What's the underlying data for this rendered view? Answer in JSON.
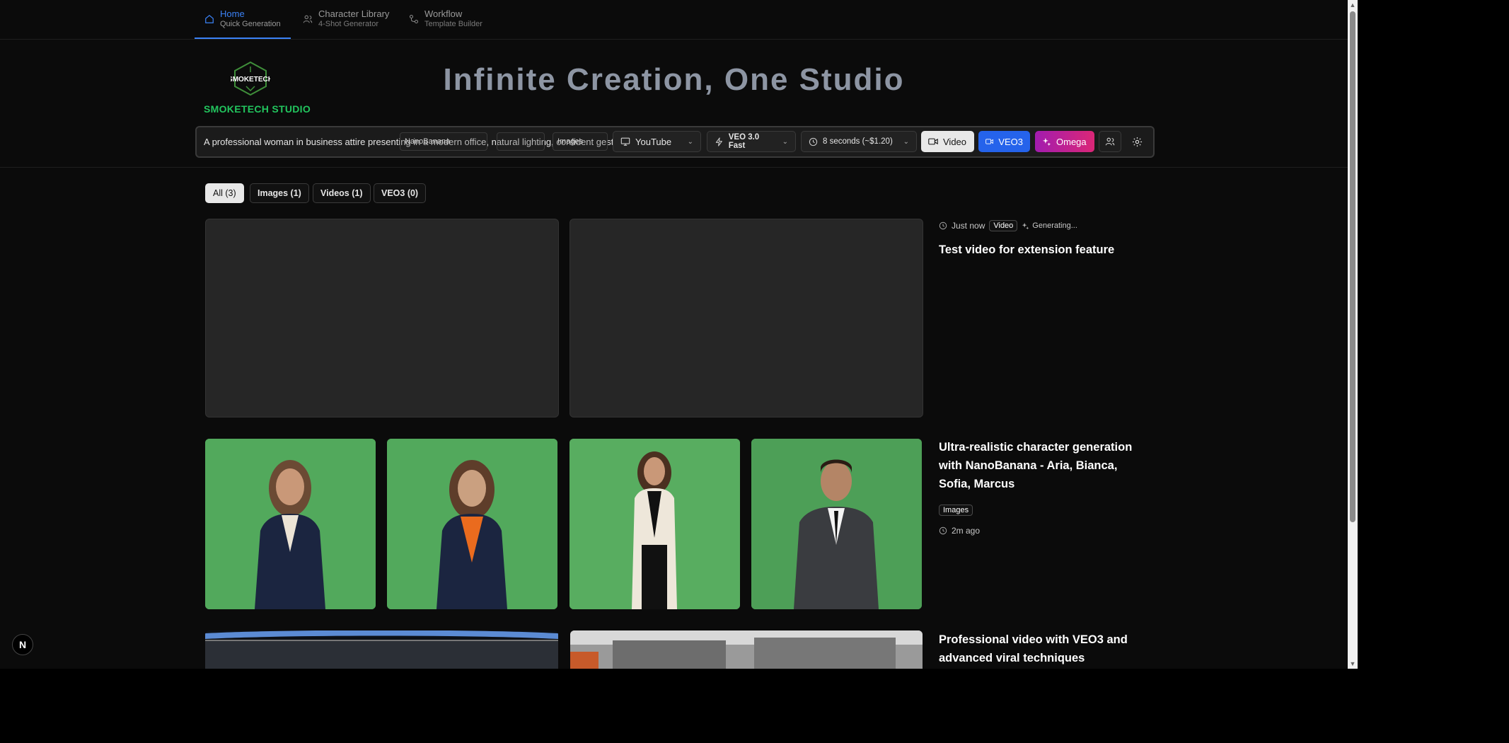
{
  "nav": {
    "items": [
      {
        "title": "Home",
        "subtitle": "Quick Generation",
        "icon": "home-icon",
        "active": true
      },
      {
        "title": "Character Library",
        "subtitle": "4-Shot Generator",
        "icon": "users-icon",
        "active": false
      },
      {
        "title": "Workflow",
        "subtitle": "Template Builder",
        "icon": "workflow-icon",
        "active": false
      }
    ]
  },
  "brand": {
    "logo_text": "SMOKETECH",
    "name": "SMOKETECH STUDIO"
  },
  "hero": {
    "title": "Infinite Creation, One Studio"
  },
  "prompt": {
    "value": "A professional woman in business attire presenting in a modern office, natural lighting, confident gestures",
    "ghost_model": "NanoBanana",
    "ghost_images": "Images",
    "platform": "YouTube",
    "model": "VEO 3.0 Fast",
    "duration": "8 seconds (~$1.20)",
    "mode_video": "Video",
    "mode_veo3": "VEO3",
    "mode_omega": "Omega"
  },
  "filters": [
    {
      "label": "All (3)",
      "active": true
    },
    {
      "label": "Images (1)",
      "active": false
    },
    {
      "label": "Videos (1)",
      "active": false
    },
    {
      "label": "VEO3 (0)",
      "active": false
    }
  ],
  "items": [
    {
      "time": "Just now",
      "type": "Video",
      "status": "Generating...",
      "title": "Test video for extension feature"
    },
    {
      "time": "2m ago",
      "type": "Images",
      "title": "Ultra-realistic character generation with NanoBanana - Aria, Bianca, Sofia, Marcus"
    },
    {
      "title": "Professional video with VEO3 and advanced viral techniques"
    }
  ],
  "dev_badge": "N",
  "colors": {
    "accent": "#3b82f6",
    "brand": "#22c55e",
    "veo3": "#2563eb",
    "omega": "#db2777"
  }
}
